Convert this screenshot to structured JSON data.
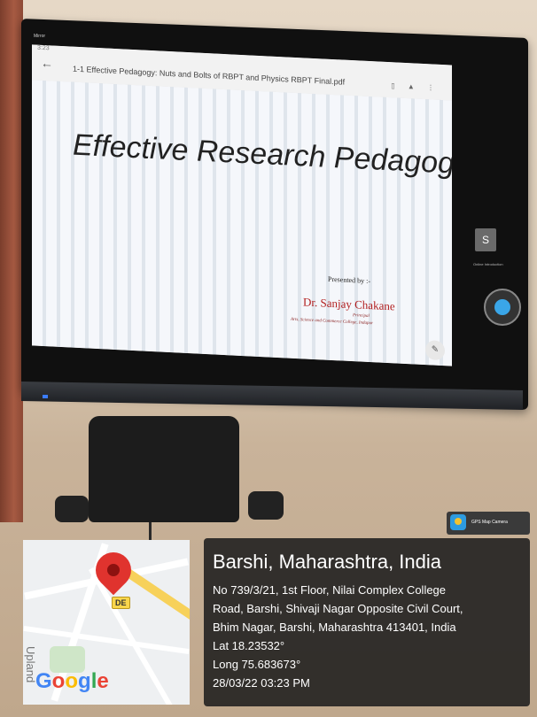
{
  "screen": {
    "status_text": "Mirror",
    "clock": "3:23",
    "file_title": "1-1 Effective Pedagogy: Nuts and Bolts of RBPT and Physics RBPT Final.pdf",
    "avatar_letter": "S",
    "app_label": "Online Introduction"
  },
  "slide": {
    "title": "Effective Research Pedagogy",
    "presented_by": "Presented by :-",
    "author": "Dr. Sanjay Chakane",
    "role": "Principal",
    "college": "Arts, Science and Commerce College, Indapur"
  },
  "gps_badge": {
    "label": "GPS Map Camera"
  },
  "location": {
    "city": "Barshi, Maharashtra, India",
    "address_line1": "No 739/3/21, 1st Floor, Nilai Complex College",
    "address_line2": "Road, Barshi, Shivaji Nagar Opposite Civil Court,",
    "address_line3": "Bhim Nagar, Barshi, Maharashtra 413401, India",
    "lat": "Lat 18.23532°",
    "long": "Long 75.683673°",
    "timestamp": "28/03/22 03:23 PM"
  },
  "map": {
    "poi_label": "DE",
    "side_label": "Upland",
    "google_letters": [
      "G",
      "o",
      "o",
      "g",
      "l",
      "e"
    ]
  }
}
